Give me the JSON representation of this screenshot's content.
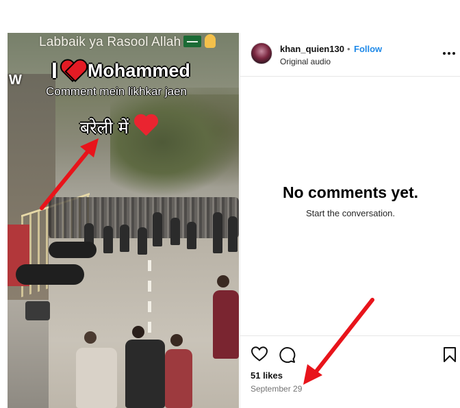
{
  "video": {
    "overlay_top": "Labbaik ya Rasool Allah",
    "overlay_w": "W",
    "overlay_i": "I",
    "overlay_name": "Mohammed",
    "overlay_comment": "Comment mein likhkar jaen",
    "overlay_hindi": "बरेली में"
  },
  "post": {
    "username": "khan_quien130",
    "separator": "•",
    "follow_label": "Follow",
    "audio": "Original audio"
  },
  "comments": {
    "empty_title": "No comments yet.",
    "empty_subtitle": "Start the conversation."
  },
  "footer": {
    "likes": "51 likes",
    "date": "September 29"
  },
  "icons": [
    "heart-icon",
    "comment-icon",
    "bookmark-icon",
    "more-icon",
    "flag-icon",
    "hand-icon"
  ],
  "colors": {
    "follow": "#1f89e8",
    "arrow": "#e8141b",
    "heart": "#e41b24"
  }
}
